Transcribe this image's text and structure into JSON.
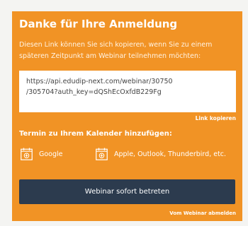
{
  "card": {
    "title": "Danke für Ihre Anmeldung",
    "description": "Diesen Link können Sie sich kopieren, wenn Sie zu einem späteren Zeitpunkt am Webinar teilnehmen möchten:",
    "link_line1": "https://api.edudip-next.com/webinar/30750",
    "link_line2": "/305704?auth_key=dQShEcOxfdB229Fg",
    "copy_label": "Link kopieren",
    "calendar_heading": "Termin zu Ihrem Kalender hinzufügen:",
    "calendar_options": [
      {
        "label": "Google",
        "icon": "calendar-icon"
      },
      {
        "label": "Apple, Outlook, Thunderbird, etc.",
        "icon": "calendar-icon"
      }
    ],
    "join_label": "Webinar sofort betreten",
    "unsubscribe_label": "Vom Webinar abmelden"
  },
  "colors": {
    "card_background": "#f19325",
    "button_background": "#2c3b4e",
    "page_background": "#f4f4f2",
    "text_white": "#ffffff"
  }
}
